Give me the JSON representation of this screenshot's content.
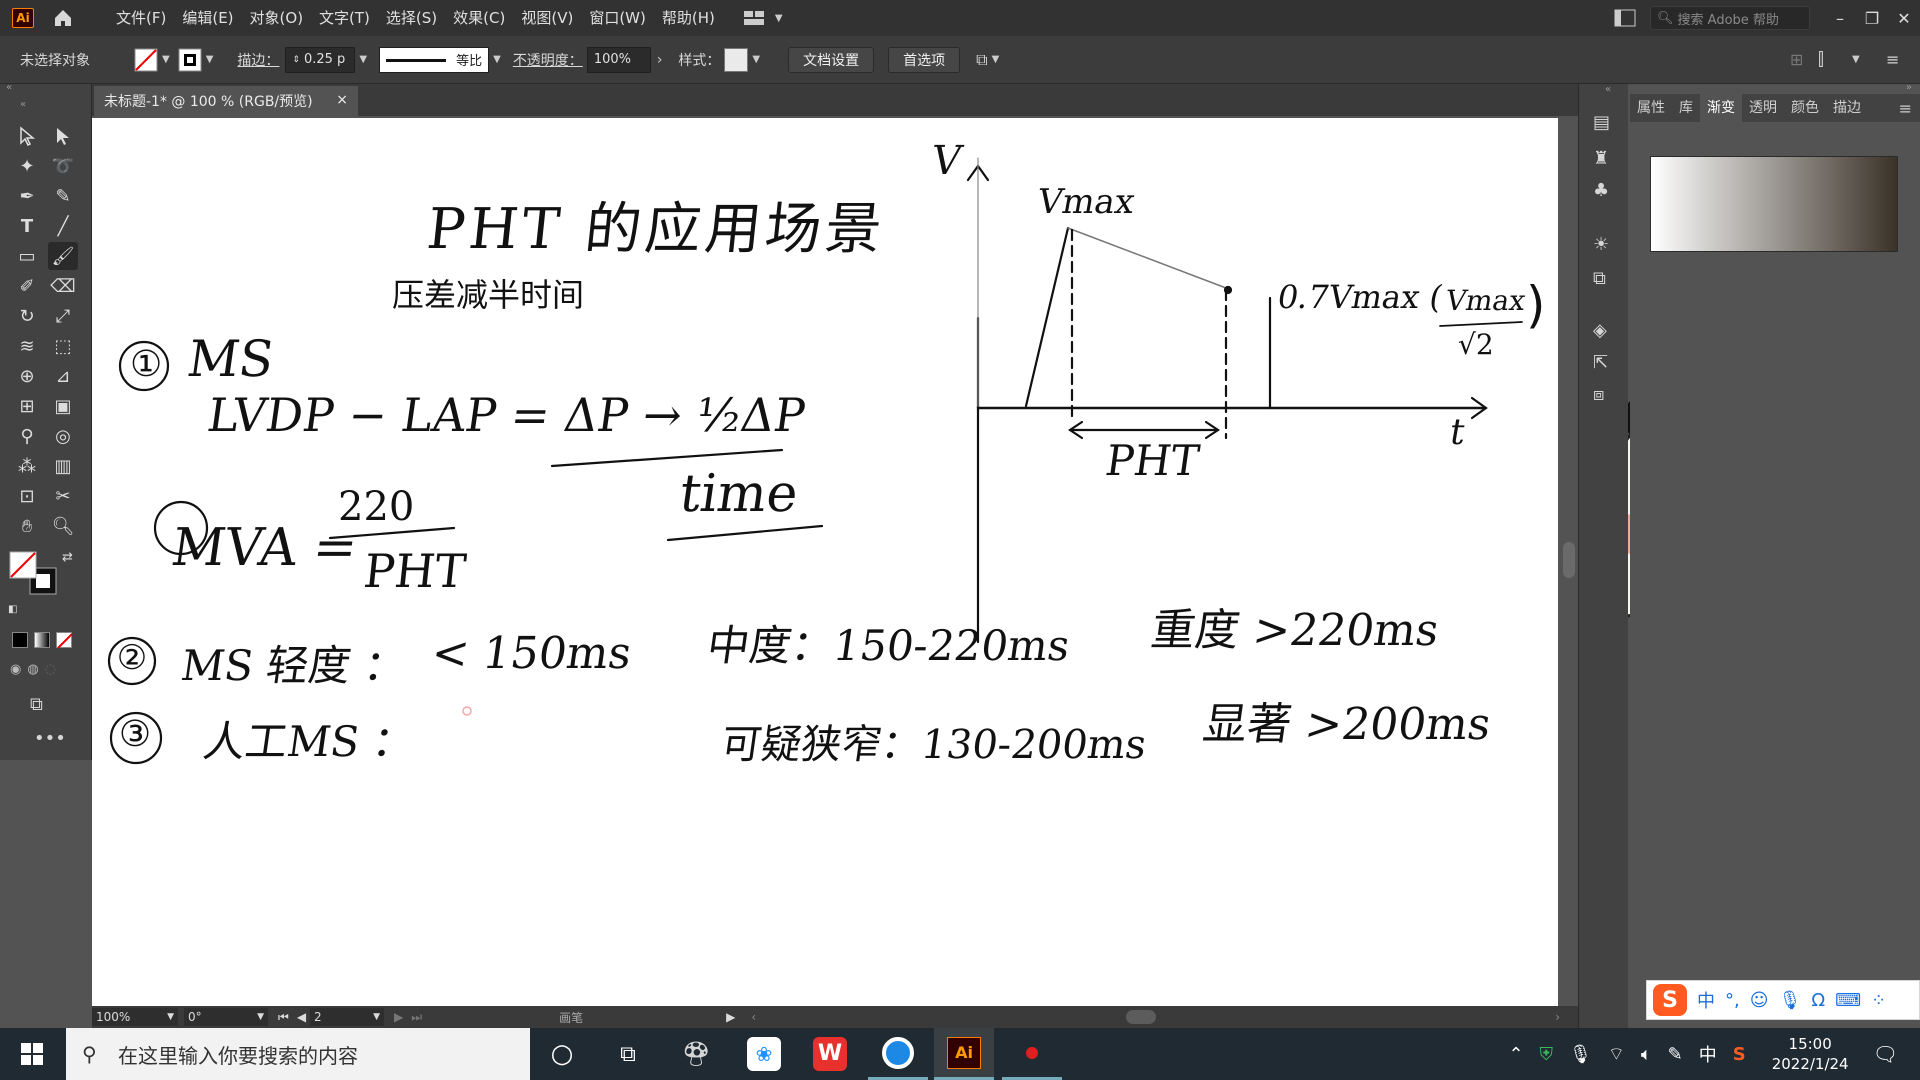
{
  "app": {
    "logo_text": "Ai",
    "menus": [
      "文件(F)",
      "编辑(E)",
      "对象(O)",
      "文字(T)",
      "选择(S)",
      "效果(C)",
      "视图(V)",
      "窗口(W)",
      "帮助(H)"
    ],
    "search_placeholder": "搜索 Adobe 帮助"
  },
  "control_bar": {
    "selection_status": "未选择对象",
    "stroke_label": "描边：",
    "stroke_value": "0.25 p",
    "profile_label": "等比",
    "opacity_label": "不透明度：",
    "opacity_value": "100%",
    "style_label": "样式：",
    "doc_setup_button": "文档设置",
    "preferences_button": "首选项"
  },
  "document": {
    "tab_title": "未标题-1* @ 100 % (RGB/预览)",
    "tab_close": "×"
  },
  "artboard": {
    "title_handwritten": "PHT 的应用场景",
    "subtitle_typed": "压差减半时间",
    "item1_num": "①",
    "item1_text": "MS",
    "formula_line": "LVDP − LAP = ΔP → ½ΔP",
    "time_word": "time",
    "mva_left": "MVA =",
    "mva_numerator": "220",
    "mva_denominator": "PHT",
    "item2_num": "②",
    "item2_text": "MS 轻度 ：",
    "item2_value": "< 150ms",
    "item2_mid": "中度：150-220ms",
    "item2_right": "重度 >220ms",
    "item3_num": "③",
    "item3_text": "人工MS ：",
    "item3_mid": "可疑狭窄：130-200ms",
    "item3_right": "显著 >200ms",
    "graph_y_label": "V",
    "graph_x_label": "t",
    "graph_vmax": "Vmax",
    "graph_07vmax": "0.7Vmax (",
    "graph_frac_num": "Vmax",
    "graph_frac_den": "√2",
    "graph_pht": "PHT"
  },
  "status_bar": {
    "zoom": "100%",
    "rotation": "0°",
    "artboard_num": "2",
    "tool_name": "画笔"
  },
  "right_panel": {
    "tabs": [
      "属性",
      "库",
      "渐变",
      "透明",
      "颜色",
      "描边"
    ],
    "active_tab": "渐变"
  },
  "taskbar": {
    "search_placeholder": "在这里输入你要搜索的内容",
    "time": "15:00",
    "date": "2022/1/24",
    "ime_lang": "中"
  },
  "colors": {
    "menubar_bg": "#323232",
    "panel_bg": "#424242",
    "canvas_bg": "#535353",
    "artboard": "#ffffff",
    "ai_orange": "#ff9a00",
    "taskbar_bg": "#1f2a33"
  }
}
